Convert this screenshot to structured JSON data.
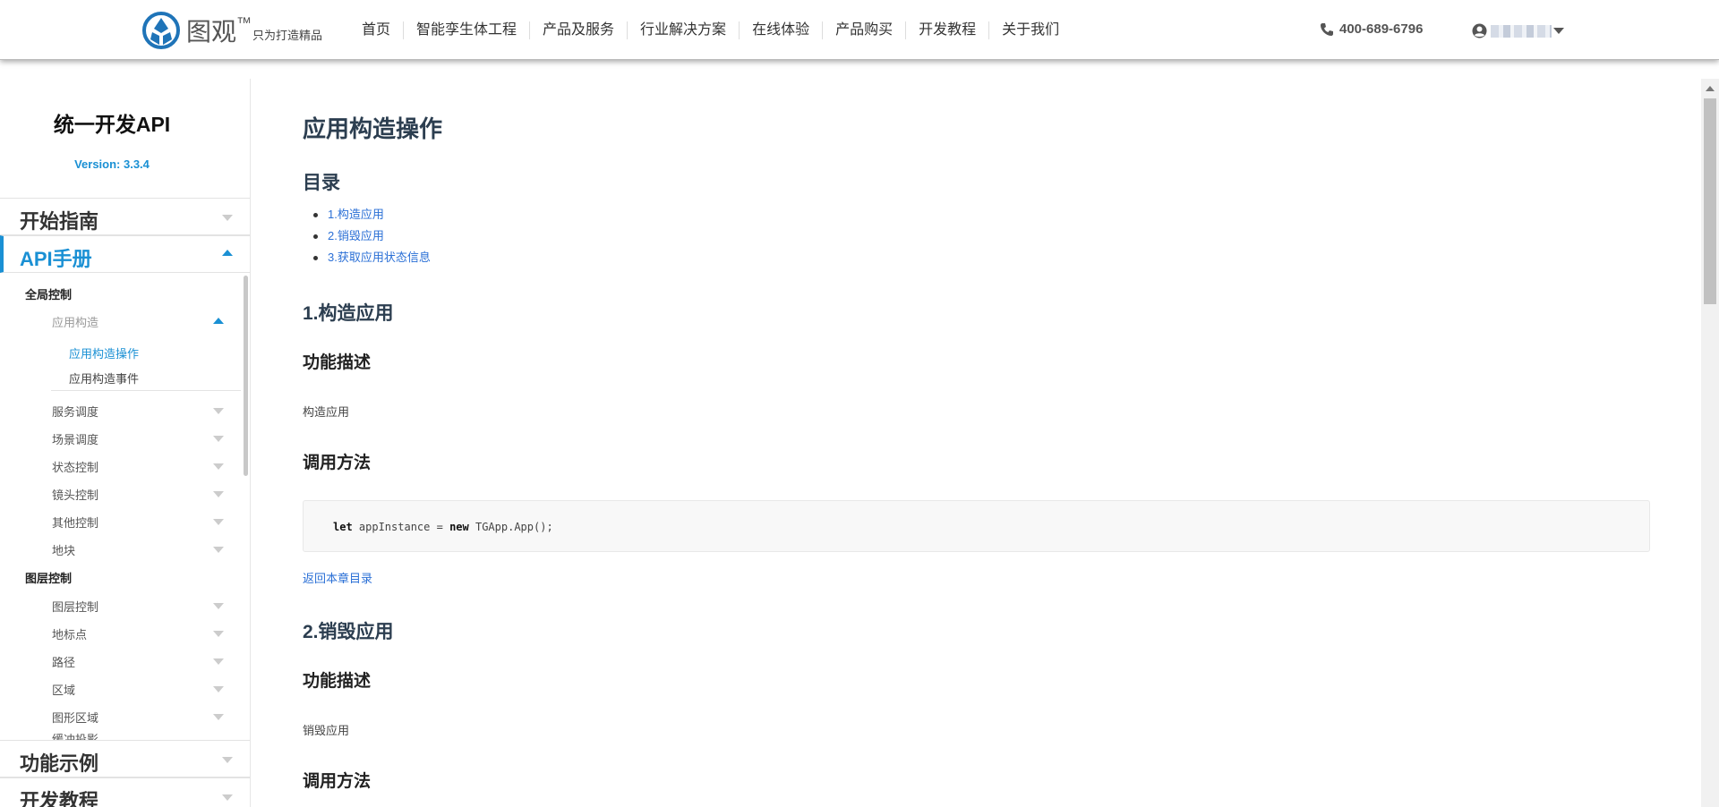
{
  "header": {
    "logo_name": "图观",
    "logo_tm": "™",
    "logo_slogan": "只为打造精品",
    "nav": [
      "首页",
      "智能孪生体工程",
      "产品及服务",
      "行业解决方案",
      "在线体验",
      "产品购买",
      "开发教程",
      "关于我们"
    ],
    "phone": "400-689-6796"
  },
  "sidebar": {
    "title": "统一开发API",
    "version": "Version: 3.3.4",
    "sections": [
      "开始指南",
      "API手册",
      "功能示例",
      "开发教程"
    ],
    "groups": [
      "全局控制",
      "图层控制"
    ],
    "global_items": {
      "expanded": "应用构造",
      "subs": [
        "应用构造操作",
        "应用构造事件"
      ],
      "rest": [
        "服务调度",
        "场景调度",
        "状态控制",
        "镜头控制",
        "其他控制",
        "地块"
      ]
    },
    "layer_items": [
      "图层控制",
      "地标点",
      "路径",
      "区域",
      "图形区域",
      "缓冲投影"
    ]
  },
  "content": {
    "title": "应用构造操作",
    "toc_heading": "目录",
    "toc": [
      "1.构造应用",
      "2.销毁应用",
      "3.获取应用状态信息"
    ],
    "sec1": {
      "heading": "1.构造应用",
      "desc_heading": "功能描述",
      "desc": "构造应用",
      "method_heading": "调用方法",
      "code": {
        "kw1": "let",
        "mid": " appInstance = ",
        "kw2": "new",
        "tail": " TGApp.App();"
      }
    },
    "back_link": "返回本章目录",
    "sec2": {
      "heading": "2.销毁应用",
      "desc_heading": "功能描述",
      "desc": "销毁应用",
      "method_heading": "调用方法"
    }
  },
  "colors": {
    "accent": "#1a90d4",
    "link": "#2a6fd6"
  }
}
